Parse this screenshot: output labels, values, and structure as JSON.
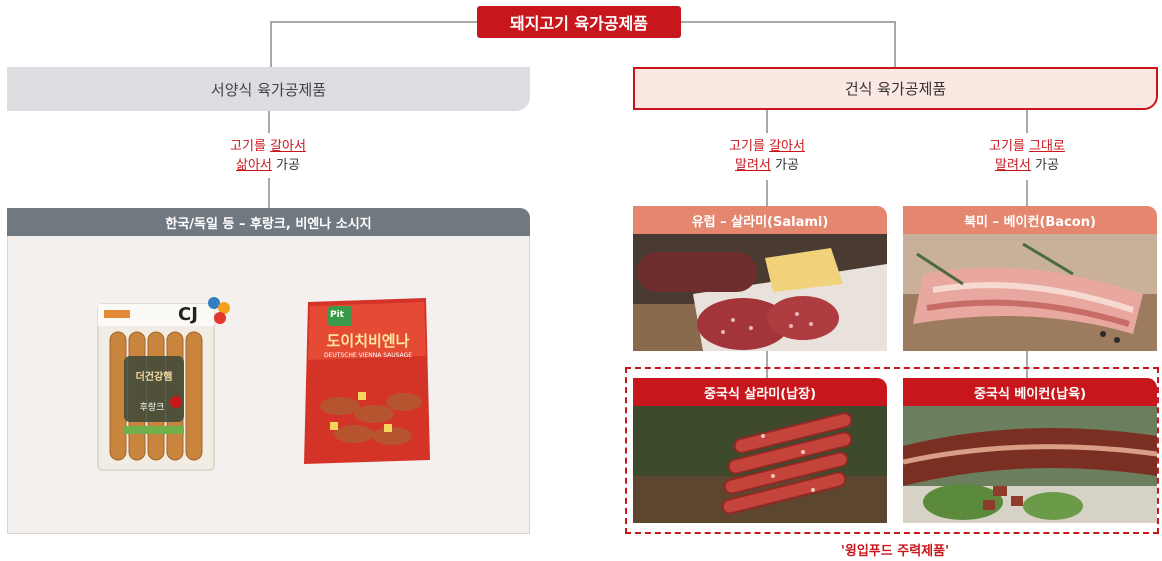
{
  "title": "돼지고기 육가공제품",
  "western": {
    "heading": "서양식 육가공제품",
    "method_line1_pre": "고기를 ",
    "method_line1_u": "갈아서",
    "method_line2_u": "삶아서",
    "method_line2_post": " 가공",
    "sub_heading": "한국/독일 등 – 후랑크, 비엔나 소시지",
    "product1": {
      "brand": "CJ",
      "package_text": "더건강햄",
      "label": "후랑크"
    },
    "product2": {
      "brand": "Pit",
      "name": "도이치비엔나",
      "small": "DEUTSCHE VIENNA SAUSAGE"
    }
  },
  "dry": {
    "heading": "건식 육가공제품",
    "method_a_line1_pre": "고기를 ",
    "method_a_line1_u": "갈아서",
    "method_a_line2_u": "말려서",
    "method_a_line2_post": " 가공",
    "method_b_line1_pre": "고기를 ",
    "method_b_line1_u": "그대로",
    "method_b_line2_u": "말려서",
    "method_b_line2_post": " 가공",
    "europe_label": "유럽 – 살라미(Salami)",
    "namerica_label": "북미 – 베이컨(Bacon)",
    "china_salami_label": "중국식 살라미(납장)",
    "china_bacon_label": "중국식 베이컨(납육)",
    "caption": "'윙입푸드 주력제품'"
  },
  "colors": {
    "accent_red": "#c8161d",
    "salmon": "#e5866e",
    "grey_bar": "#717980",
    "light_grey": "#dcdde1",
    "pink_bg": "#fbe8e3"
  }
}
